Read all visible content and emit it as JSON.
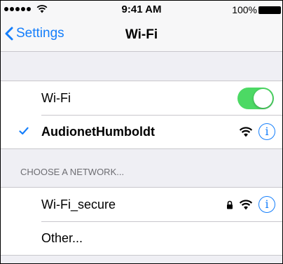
{
  "status_bar": {
    "time": "9:41 AM",
    "battery": "100%"
  },
  "nav": {
    "back_label": "Settings",
    "title": "Wi-Fi"
  },
  "wifi_toggle": {
    "label": "Wi-Fi",
    "enabled": true
  },
  "connected_network": {
    "name": "AudionetHumboldt"
  },
  "section_header": "CHOOSE A NETWORK...",
  "networks": [
    {
      "name": "Wi-Fi_secure",
      "locked": true
    },
    {
      "name": "Other..."
    }
  ],
  "colors": {
    "accent": "#147efb",
    "toggle_on": "#4cd964",
    "background": "#efeff4"
  }
}
